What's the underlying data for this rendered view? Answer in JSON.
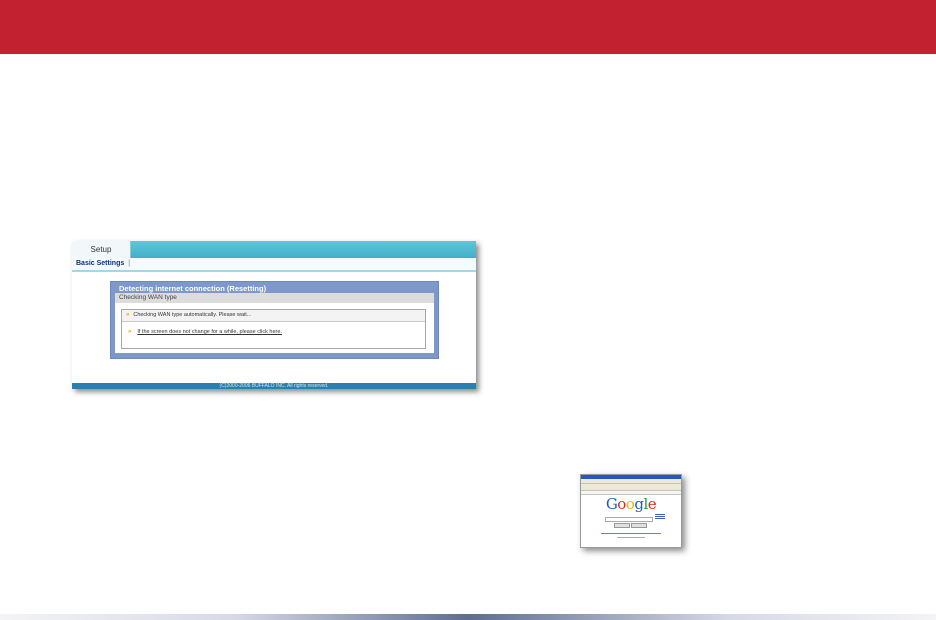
{
  "router_screen": {
    "tab_label": "Setup",
    "subnav_item": "Basic Settings",
    "subnav_separator": "|",
    "dialog_title": "Detecting internet connection (Resetting)",
    "section_header": "Checking WAN type",
    "status_arrow": "»",
    "status_message": "Checking WAN type automatically. Please wait...",
    "help_arrow": "»",
    "help_link": "If the screen does not change for a while, please click here.",
    "footer": "(C)2000-2006 BUFFALO INC. All rights reserved."
  },
  "browser_thumbnail": {
    "logo": "Google"
  },
  "colors": {
    "banner": "#c2222f",
    "router_tabbar": "#3fb0c9",
    "dialog_frame": "#7e98c9",
    "arrow": "#f29b1f",
    "footer": "#2a7fae"
  }
}
